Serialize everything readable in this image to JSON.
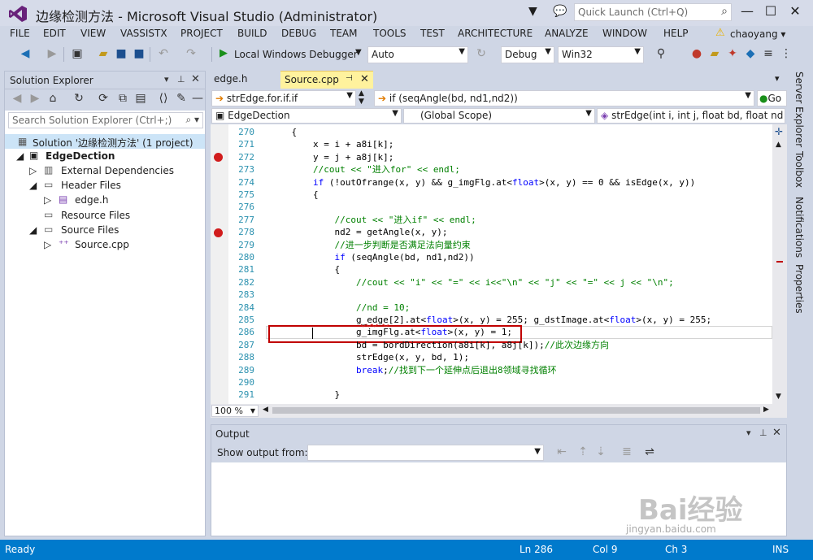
{
  "window": {
    "title": "边缘检测方法 - Microsoft Visual Studio (Administrator)",
    "quick_launch_placeholder": "Quick Launch (Ctrl+Q)"
  },
  "menu": [
    "FILE",
    "EDIT",
    "VIEW",
    "VASSISTX",
    "PROJECT",
    "BUILD",
    "DEBUG",
    "TEAM",
    "TOOLS",
    "TEST",
    "ARCHITECTURE",
    "ANALYZE",
    "WINDOW",
    "HELP"
  ],
  "user": "chaoyang",
  "toolbar": {
    "debugger_label": "Local Windows Debugger",
    "auto_value": "Auto",
    "config_value": "Debug",
    "platform_value": "Win32"
  },
  "solution_explorer": {
    "title": "Solution Explorer",
    "search_placeholder": "Search Solution Explorer (Ctrl+;)",
    "solution": "Solution '边缘检测方法' (1 project)",
    "project": "EdgeDection",
    "nodes": [
      "External Dependencies",
      "Header Files",
      "edge.h",
      "Resource Files",
      "Source Files",
      "Source.cpp"
    ]
  },
  "editor": {
    "tabs": [
      "edge.h",
      "Source.cpp"
    ],
    "nav_scope_left": "strEdge.for.if.if",
    "nav_scope_right": "if (seqAngle(bd, nd1,nd2))",
    "go_label": "Go",
    "project_combo": "EdgeDection",
    "global_scope": "(Global Scope)",
    "function_combo": "strEdge(int i, int j, float bd, float nd",
    "zoom": "100 %",
    "line_numbers": [
      "270",
      "271",
      "272",
      "273",
      "274",
      "275",
      "276",
      "277",
      "278",
      "279",
      "280",
      "281",
      "282",
      "283",
      "284",
      "285",
      "286",
      "287",
      "288",
      "289",
      "290",
      "291"
    ]
  },
  "output": {
    "title": "Output",
    "show_output_label": "Show output from:"
  },
  "side_tabs": [
    "Server Explorer",
    "Toolbox",
    "Notifications",
    "Properties"
  ],
  "status": {
    "ready": "Ready",
    "ln": "Ln 286",
    "col": "Col 9",
    "ch": "Ch 3",
    "ins": "INS"
  },
  "watermark": {
    "brand": "Bai经验",
    "url": "jingyan.baidu.com"
  },
  "colors": {
    "accent": "#007acc",
    "active_tab": "#fff29d",
    "breakpoint": "#d11c1c",
    "highlight_box": "#c00000"
  }
}
